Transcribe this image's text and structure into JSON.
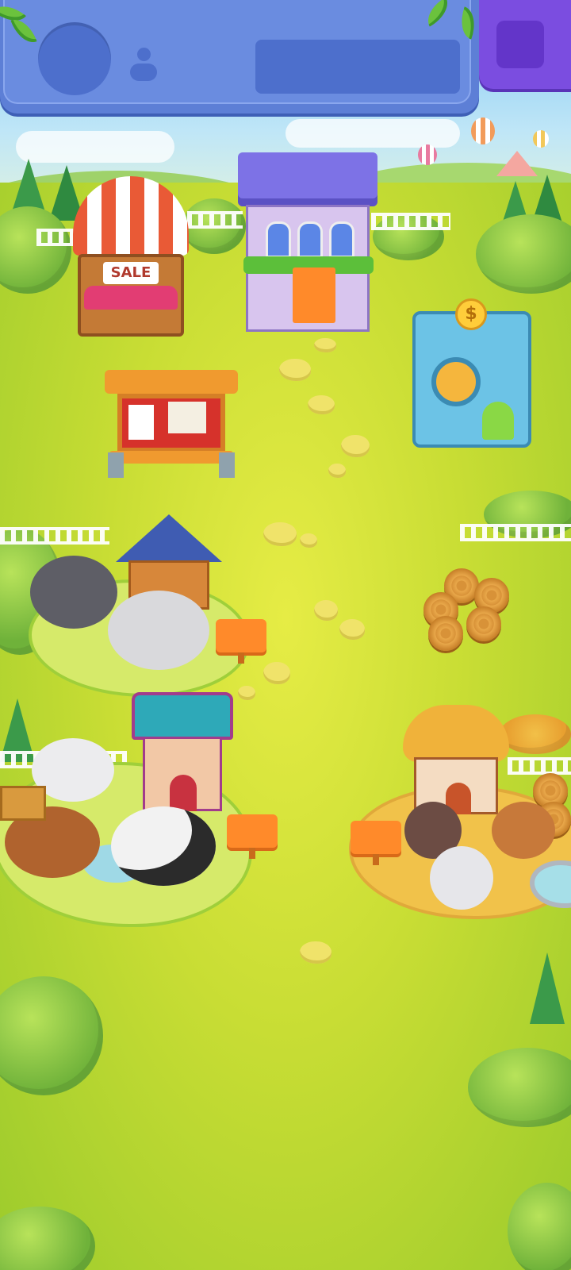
{
  "hud": {
    "avatar_icon": "avatar-placeholder",
    "user_icon": "user-icon",
    "name_value": "",
    "menu_icon": "menu-button-placeholder",
    "colors": {
      "hud": "#5d7fd6",
      "menu": "#7b4de0"
    }
  },
  "buildings": {
    "market_stall": {
      "sign_text": "SALE"
    },
    "shop": {
      "banner_text": ""
    },
    "vault": {
      "coin_symbol": "$"
    },
    "notice_board": {},
    "sheep_house": {
      "sign_text": ""
    },
    "cow_house": {
      "sign_text": ""
    },
    "chicken_house": {
      "sign_text": ""
    },
    "hay_bales": {}
  },
  "colors": {
    "grass": "#c9dd3a",
    "sign_orange": "#ff8a2a",
    "path": "#f0e36a"
  }
}
